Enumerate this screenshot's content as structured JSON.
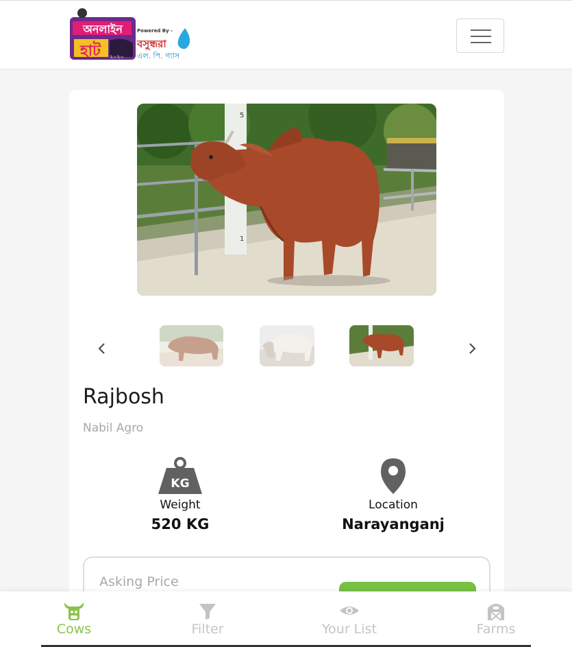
{
  "header": {
    "logo_tag": "Powered By -"
  },
  "product": {
    "name": "Rajbosh",
    "farm": "Nabil Agro",
    "weight_label": "Weight",
    "weight_value": "520 KG",
    "weight_icon_text": "KG",
    "location_label": "Location",
    "location_value": "Narayanganj",
    "price_label": "Asking Price"
  },
  "gallery": {
    "thumbnail_count": 3,
    "active_thumbnail": 3
  },
  "nav": {
    "items": [
      {
        "label": "Cows",
        "icon": "cow-icon"
      },
      {
        "label": "Filter",
        "icon": "filter-icon"
      },
      {
        "label": "Your List",
        "icon": "eye-icon"
      },
      {
        "label": "Farms",
        "icon": "barn-icon"
      }
    ],
    "active_index": 0
  },
  "colors": {
    "accent": "#8bc34a",
    "button_green": "#77c043",
    "muted": "#a8a8a8"
  }
}
